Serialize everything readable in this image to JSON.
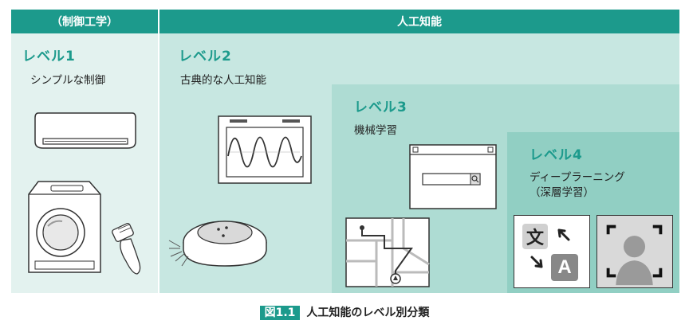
{
  "header": {
    "left": "（制御工学）",
    "right": "人工知能"
  },
  "levels": [
    {
      "title": "レベル1",
      "desc": "シンプルな制御"
    },
    {
      "title": "レベル2",
      "desc": "古典的な人工知能"
    },
    {
      "title": "レベル3",
      "desc": "機械学習"
    },
    {
      "title": "レベル4",
      "desc_line1": "ディープラーニング",
      "desc_line2": "（深層学習）"
    }
  ],
  "translate_icon": {
    "kanji": "文",
    "latin": "A"
  },
  "caption": {
    "badge": "図1.1",
    "text": "人工知能のレベル別分類"
  },
  "colors": {
    "accent": "#1c9a8c",
    "level1_bg": "#e3f2ef",
    "level2_bg": "#c7e7e1",
    "level3_bg": "#aedcd3",
    "level4_bg": "#91cfc3"
  }
}
